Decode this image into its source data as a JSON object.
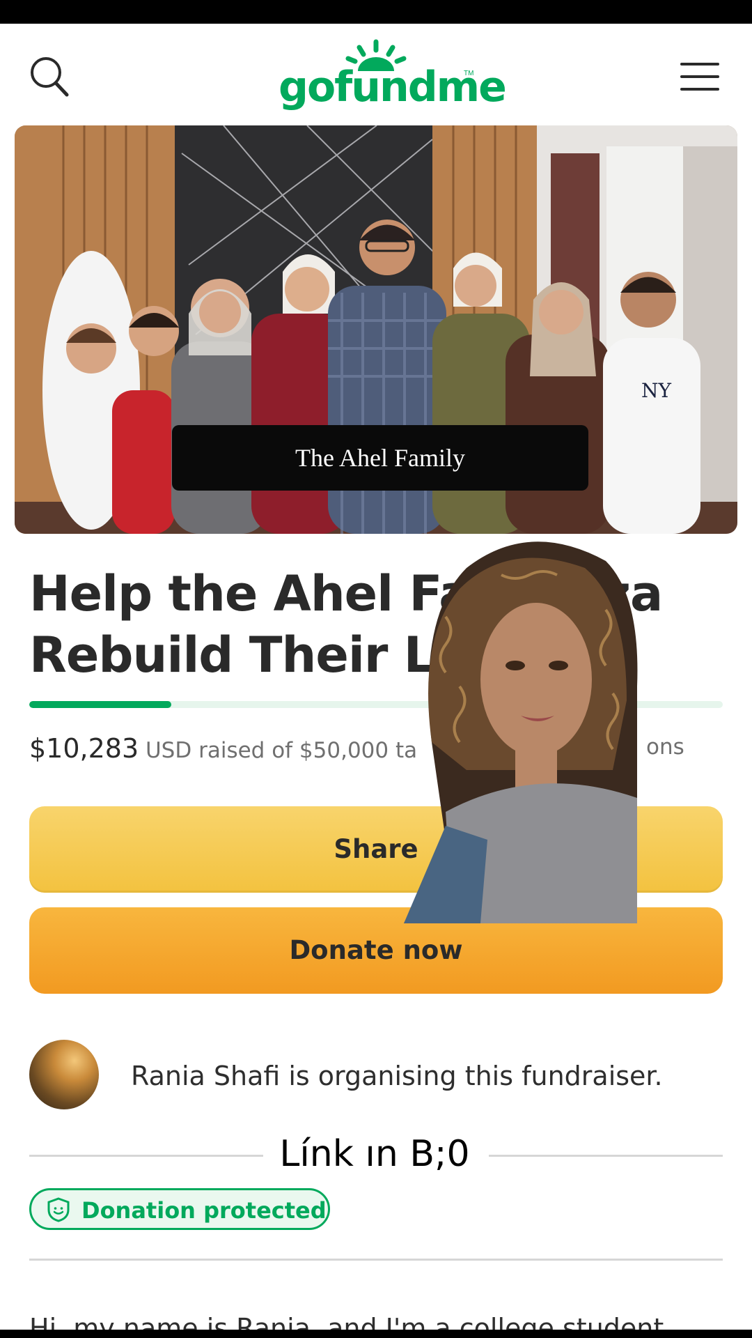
{
  "header": {
    "logo_text": "gofundme",
    "logo_tm": "TM",
    "search_icon": "search-icon",
    "menu_icon": "hamburger-menu-icon"
  },
  "hero": {
    "caption": "The Ahel Family"
  },
  "campaign": {
    "title": "Help the Ahel Fam         za Rebuild Their Live",
    "raised_amount": "$10,283",
    "raised_text": " USD raised of $50,000 ta",
    "donations_fragment": "ons",
    "progress_fraction": 0.205
  },
  "buttons": {
    "share_label": "Share",
    "donate_label": "Donate now"
  },
  "organiser": {
    "text": "Rania Shafi is organising this fundraiser."
  },
  "overlay": {
    "text": "Línk ın B;0"
  },
  "badge": {
    "label": "Donation protected",
    "icon": "shield-icon"
  },
  "story": {
    "first_line": "Hi, my name is Rania, and I'm a college student"
  },
  "colors": {
    "brand_green": "#02a95c",
    "share_yellow": "#f5c94d",
    "donate_orange": "#f4a52b"
  }
}
